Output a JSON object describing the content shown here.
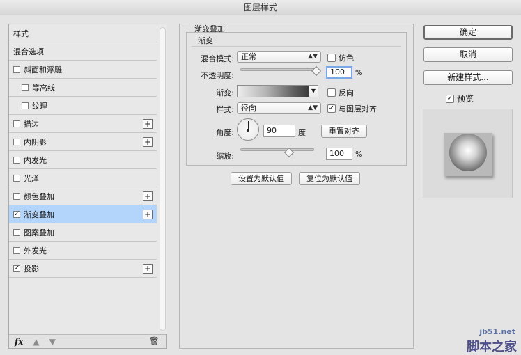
{
  "window": {
    "title": "图层样式"
  },
  "styles_panel": {
    "items": [
      {
        "label": "样式",
        "has_checkbox": false,
        "checked": false,
        "has_plus": false,
        "sub": false,
        "selected": false
      },
      {
        "label": "混合选项",
        "has_checkbox": false,
        "checked": false,
        "has_plus": false,
        "sub": false,
        "selected": false
      },
      {
        "label": "斜面和浮雕",
        "has_checkbox": true,
        "checked": false,
        "has_plus": false,
        "sub": false,
        "selected": false
      },
      {
        "label": "等高线",
        "has_checkbox": true,
        "checked": false,
        "has_plus": false,
        "sub": true,
        "selected": false
      },
      {
        "label": "纹理",
        "has_checkbox": true,
        "checked": false,
        "has_plus": false,
        "sub": true,
        "selected": false
      },
      {
        "label": "描边",
        "has_checkbox": true,
        "checked": false,
        "has_plus": true,
        "sub": false,
        "selected": false
      },
      {
        "label": "内阴影",
        "has_checkbox": true,
        "checked": false,
        "has_plus": true,
        "sub": false,
        "selected": false
      },
      {
        "label": "内发光",
        "has_checkbox": true,
        "checked": false,
        "has_plus": false,
        "sub": false,
        "selected": false
      },
      {
        "label": "光泽",
        "has_checkbox": true,
        "checked": false,
        "has_plus": false,
        "sub": false,
        "selected": false
      },
      {
        "label": "颜色叠加",
        "has_checkbox": true,
        "checked": false,
        "has_plus": true,
        "sub": false,
        "selected": false
      },
      {
        "label": "渐变叠加",
        "has_checkbox": true,
        "checked": true,
        "has_plus": true,
        "sub": false,
        "selected": true
      },
      {
        "label": "图案叠加",
        "has_checkbox": true,
        "checked": false,
        "has_plus": false,
        "sub": false,
        "selected": false
      },
      {
        "label": "外发光",
        "has_checkbox": true,
        "checked": false,
        "has_plus": false,
        "sub": false,
        "selected": false
      },
      {
        "label": "投影",
        "has_checkbox": true,
        "checked": true,
        "has_plus": true,
        "sub": false,
        "selected": false
      }
    ],
    "footer": {
      "fx_label": "fx",
      "icons": [
        "fx-icon",
        "arrow-up-icon",
        "arrow-down-icon",
        "trash-icon"
      ]
    }
  },
  "gradient_overlay": {
    "group_title": "渐变叠加",
    "sub_title": "渐变",
    "blend_mode_label": "混合模式:",
    "blend_mode_value": "正常",
    "dither_label": "仿色",
    "dither_checked": false,
    "opacity_label": "不透明度:",
    "opacity_value": "100",
    "opacity_percent": 100,
    "percent_sign": "%",
    "gradient_label": "渐变:",
    "reverse_label": "反向",
    "reverse_checked": false,
    "style_label": "样式:",
    "style_value": "径向",
    "align_label": "与图层对齐",
    "align_checked": true,
    "angle_label": "角度:",
    "angle_value": "90",
    "angle_unit": "度",
    "reset_align_label": "重置对齐",
    "scale_label": "缩放:",
    "scale_value": "100",
    "scale_percent": 100,
    "set_default_label": "设置为默认值",
    "reset_default_label": "复位为默认值"
  },
  "actions": {
    "ok_label": "确定",
    "cancel_label": "取消",
    "new_style_label": "新建样式...",
    "preview_label": "预览",
    "preview_checked": true
  },
  "watermark": {
    "url": "jb51.net",
    "name": "脚本之家"
  },
  "colors": {
    "selected_row": "#b4d5fb",
    "focus_ring": "#7aa7e6",
    "watermark": "#4f4f8a"
  }
}
